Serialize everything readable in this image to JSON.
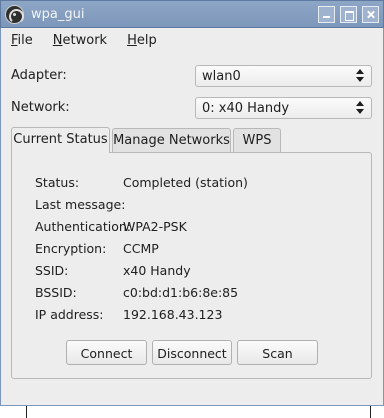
{
  "window": {
    "title": "wpa_gui"
  },
  "menu": [
    {
      "label": "File",
      "mnemonic": "F",
      "rest": "ile"
    },
    {
      "label": "Network",
      "mnemonic": "N",
      "rest": "etwork"
    },
    {
      "label": "Help",
      "mnemonic": "H",
      "rest": "elp"
    }
  ],
  "adapter": {
    "label": "Adapter:",
    "value": "wlan0"
  },
  "network": {
    "label": "Network:",
    "value": "0: x40 Handy"
  },
  "tabs": [
    "Current Status",
    "Manage Networks",
    "WPS"
  ],
  "status": {
    "rows": [
      {
        "label": "Status:",
        "value": "Completed (station)"
      },
      {
        "label": "Last message:",
        "value": ""
      },
      {
        "label": "Authentication:",
        "value": "WPA2-PSK"
      },
      {
        "label": "Encryption:",
        "value": "CCMP"
      },
      {
        "label": "SSID:",
        "value": "x40 Handy"
      },
      {
        "label": "BSSID:",
        "value": "c0:bd:d1:b6:8e:85"
      },
      {
        "label": "IP address:",
        "value": "192.168.43.123"
      }
    ]
  },
  "buttons": {
    "connect": "Connect",
    "disconnect": "Disconnect",
    "scan": "Scan"
  }
}
